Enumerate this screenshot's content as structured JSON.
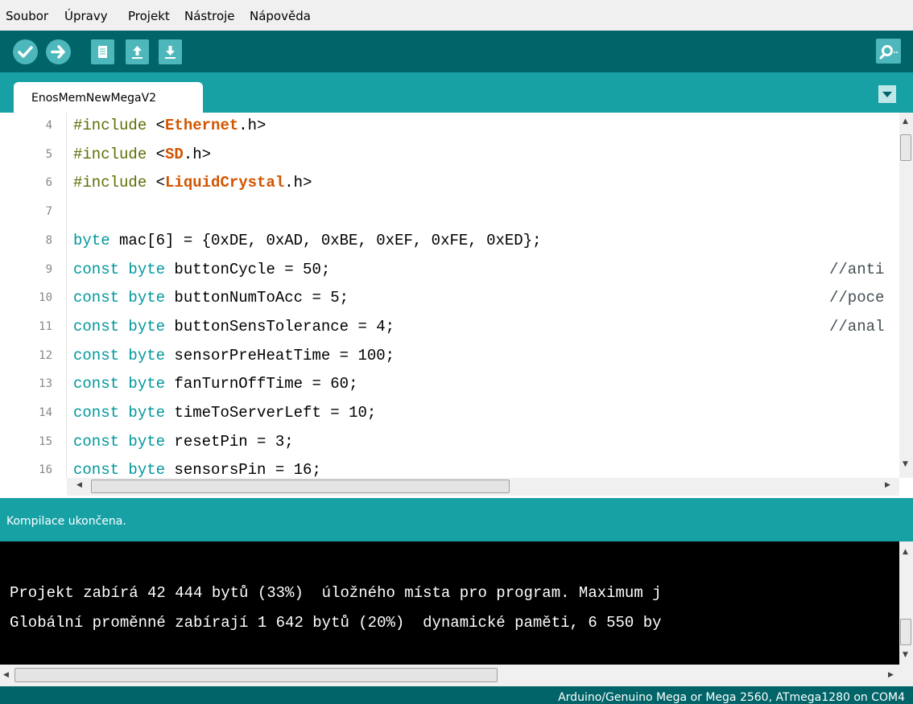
{
  "menu": [
    "Soubor",
    "Úpravy",
    "Projekt",
    "Nástroje",
    "Nápověda"
  ],
  "toolbar": {
    "verify_icon": "check-icon",
    "upload_icon": "arrow-right-icon",
    "new_icon": "document-icon",
    "open_icon": "arrow-up-icon",
    "save_icon": "arrow-down-icon",
    "serial_icon": "magnifier-icon"
  },
  "tab": {
    "label": "EnosMemNewMegaV2"
  },
  "editor": {
    "lines": [
      {
        "n": "4",
        "text": "#include <Ethernet.h>"
      },
      {
        "n": "5",
        "text": "#include <SD.h>"
      },
      {
        "n": "6",
        "text": "#include <LiquidCrystal.h>"
      },
      {
        "n": "7",
        "text": ""
      },
      {
        "n": "8",
        "text": "byte mac[6] = {0xDE, 0xAD, 0xBE, 0xEF, 0xFE, 0xED};"
      },
      {
        "n": "9",
        "text": "const byte buttonCycle = 50;",
        "comment": "//anti"
      },
      {
        "n": "10",
        "text": "const byte buttonNumToAcc = 5;",
        "comment": "//poce"
      },
      {
        "n": "11",
        "text": "const byte buttonSensTolerance = 4;",
        "comment": "//anal"
      },
      {
        "n": "12",
        "text": "const byte sensorPreHeatTime = 100;"
      },
      {
        "n": "13",
        "text": "const byte fanTurnOffTime = 60;"
      },
      {
        "n": "14",
        "text": "const byte timeToServerLeft = 10;"
      },
      {
        "n": "15",
        "text": "const byte resetPin = 3;"
      },
      {
        "n": "16",
        "text": "const byte sensorsPin = 16;"
      }
    ]
  },
  "status": {
    "text": "Kompilace ukončena."
  },
  "console": {
    "lines": [
      "Projekt zabírá 42 444 bytů (33%)  úložného místa pro program. Maximum j",
      "Globální proměnné zabírají 1 642 bytů (20%)  dynamické paměti, 6 550 by"
    ]
  },
  "footer": {
    "board": "Arduino/Genuino Mega or Mega 2560, ATmega1280 on COM4"
  },
  "colors": {
    "toolbar_bg": "#006468",
    "tab_bar_bg": "#17a1a5",
    "button_bg": "#4db7bb",
    "keyword_type": "#00979c",
    "keyword_lib": "#d35400",
    "preprocessor": "#5e6d03"
  }
}
